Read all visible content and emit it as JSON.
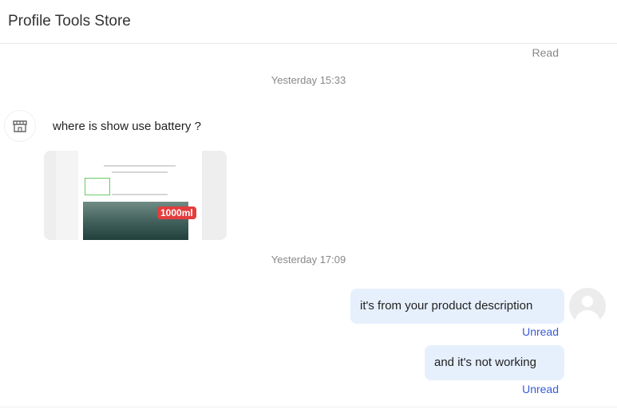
{
  "header": {
    "title": "Profile Tools Store"
  },
  "messages": {
    "read_status_top": "Read",
    "timestamp_1": "Yesterday 15:33",
    "store_message": "where is show use battery ?",
    "image_badge": "1000ml",
    "timestamp_2": "Yesterday 17:09",
    "user_message_1": "it's from your product description",
    "user_message_1_status": "Unread",
    "user_message_2": "and it's not working",
    "user_message_2_status": "Unread"
  },
  "colors": {
    "bubble": "#e6f0fd",
    "unread": "#3b5bd6",
    "timestamp": "#888888"
  },
  "icons": {
    "store_avatar": "store-icon",
    "user_avatar": "user-icon"
  }
}
